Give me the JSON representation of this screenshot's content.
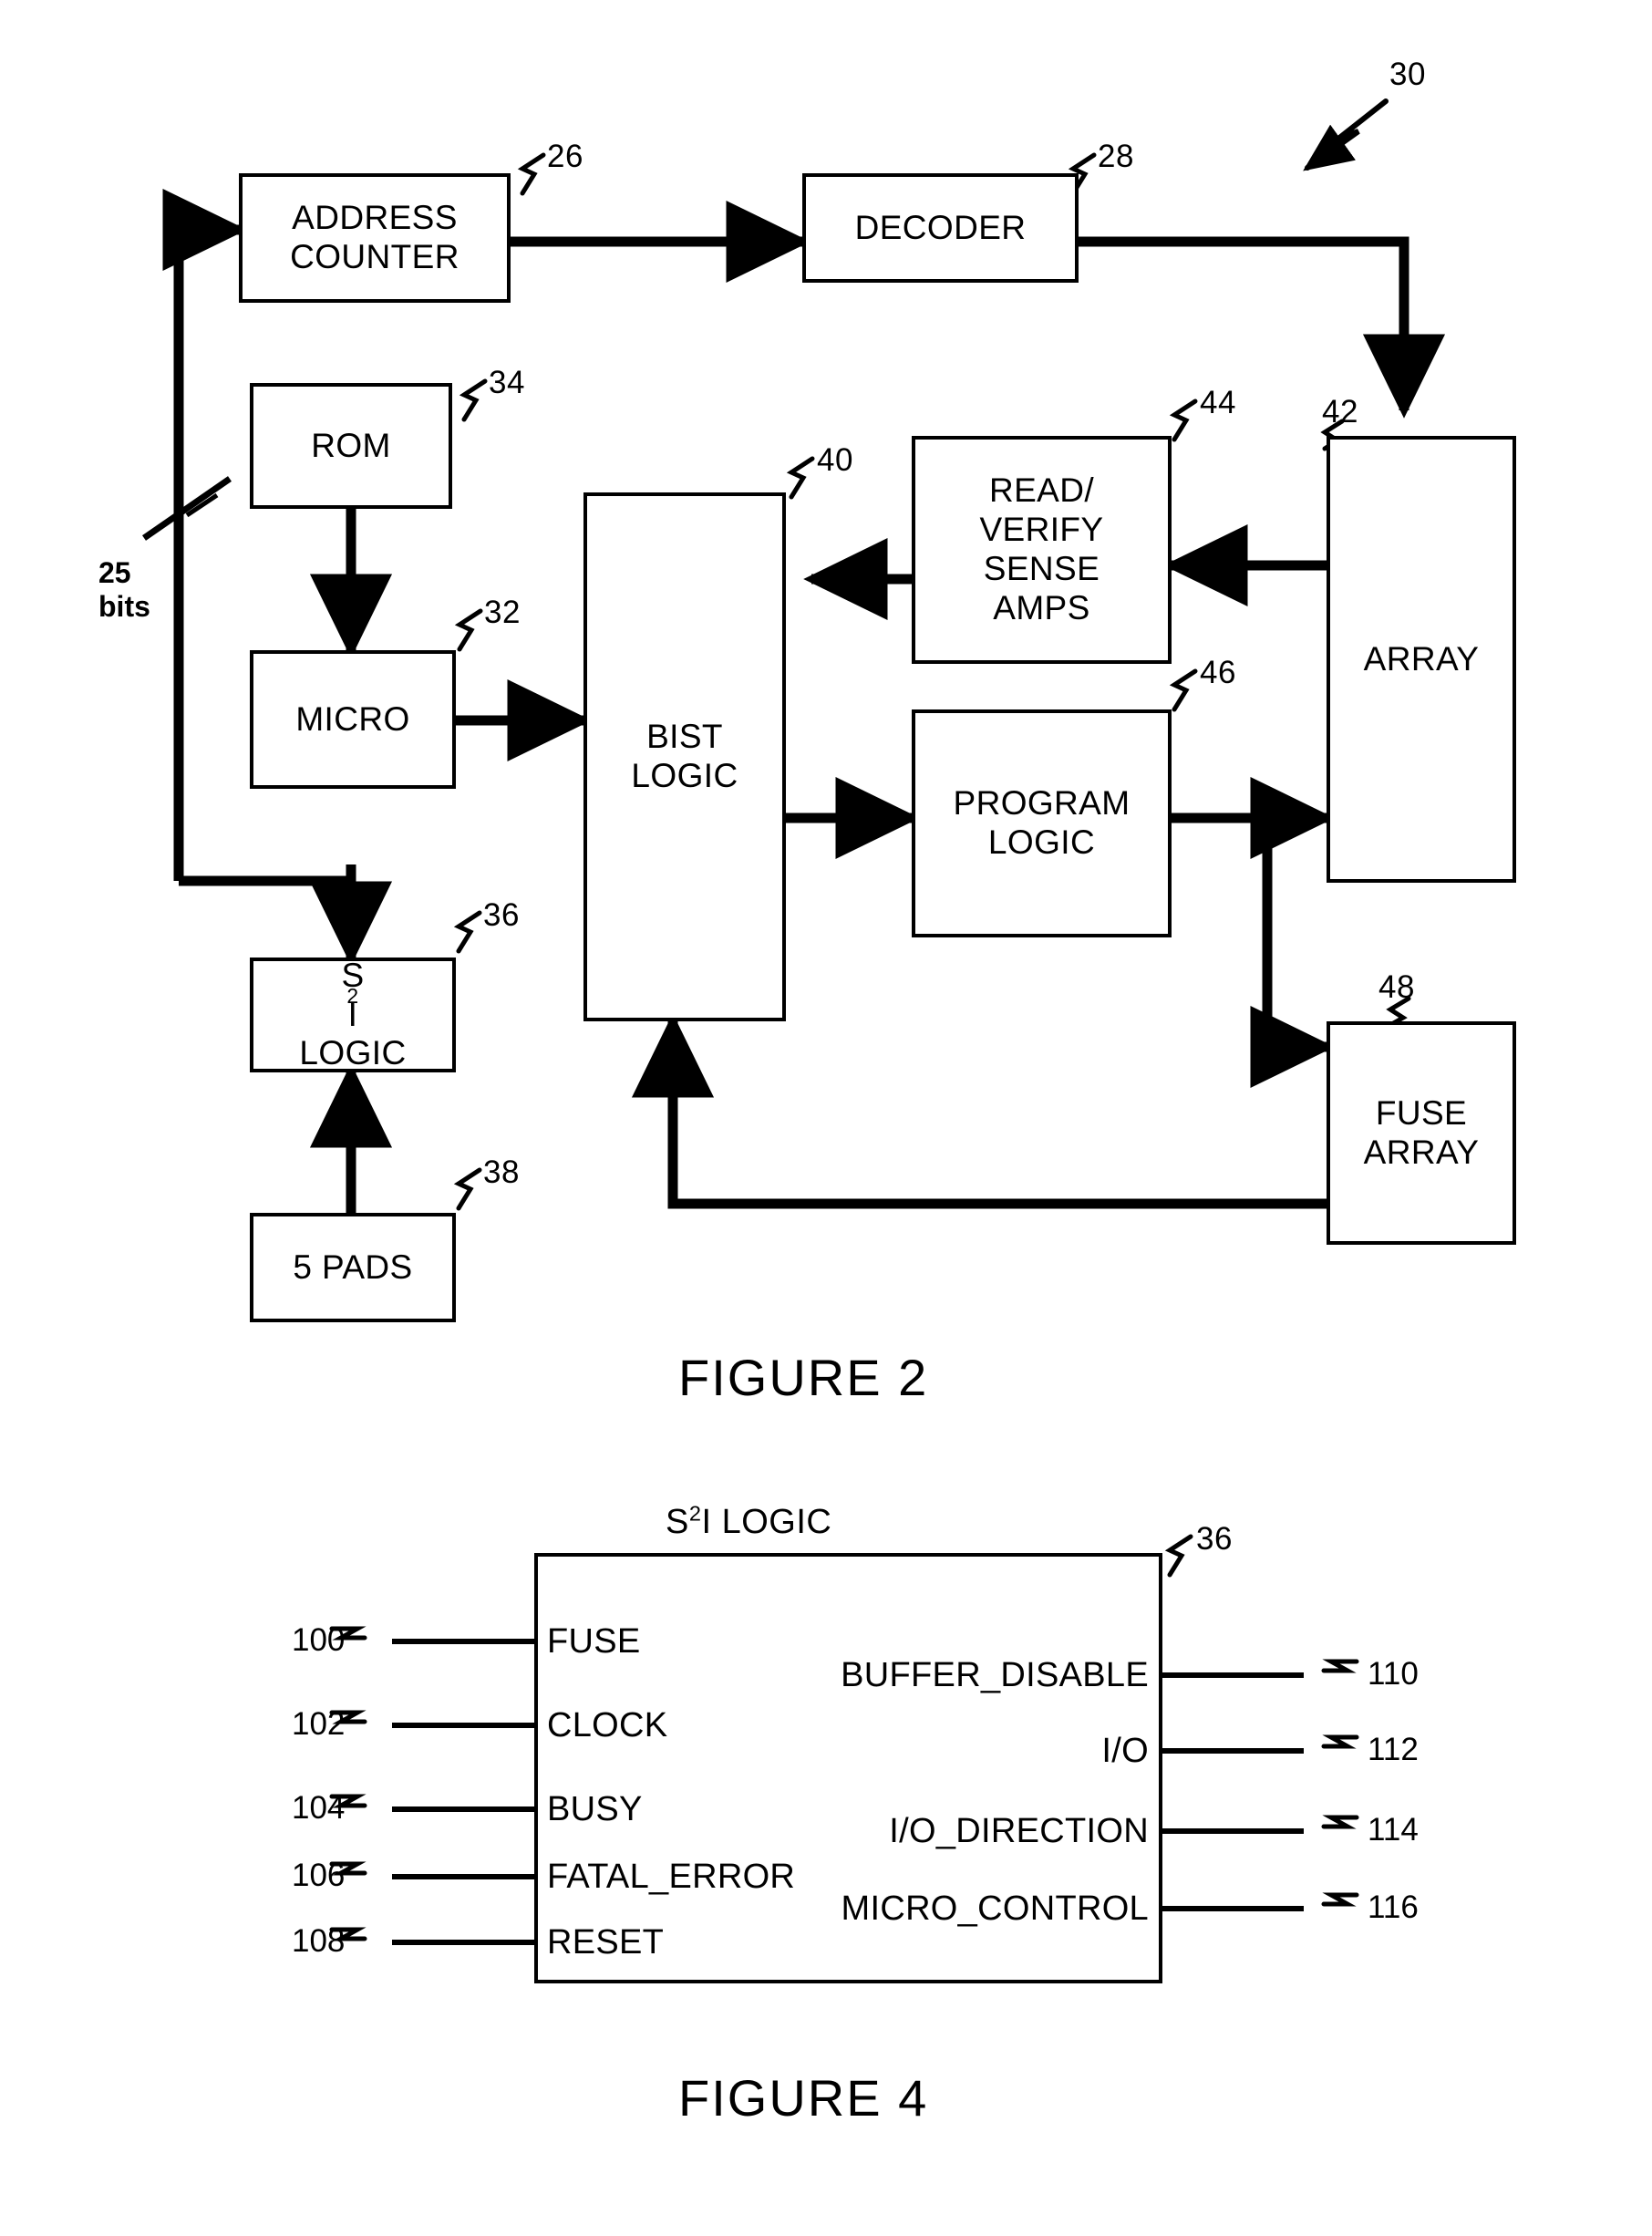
{
  "document": {
    "type": "patent-drawing-sheet",
    "ink_color": "#000000",
    "background_color": "#ffffff"
  },
  "figure2": {
    "caption": "FIGURE 2",
    "system_ref": "30",
    "bus_label_line1": "25",
    "bus_label_line2": "bits",
    "blocks": [
      {
        "id": "address-counter",
        "label_lines": [
          "ADDRESS",
          "COUNTER"
        ],
        "ref": "26"
      },
      {
        "id": "decoder",
        "label_lines": [
          "DECODER"
        ],
        "ref": "28"
      },
      {
        "id": "rom",
        "label_lines": [
          "ROM"
        ],
        "ref": "34"
      },
      {
        "id": "micro",
        "label_lines": [
          "MICRO"
        ],
        "ref": "32"
      },
      {
        "id": "s2i-logic",
        "label_lines": [
          "S2I",
          "LOGIC"
        ],
        "ref": "36"
      },
      {
        "id": "pads",
        "label_lines": [
          "5 PADS"
        ],
        "ref": "38"
      },
      {
        "id": "bist-logic",
        "label_lines": [
          "BIST",
          "LOGIC"
        ],
        "ref": "40"
      },
      {
        "id": "sense-amps",
        "label_lines": [
          "READ/",
          "VERIFY",
          "SENSE",
          "AMPS"
        ],
        "ref": "44"
      },
      {
        "id": "program-logic",
        "label_lines": [
          "PROGRAM",
          "LOGIC"
        ],
        "ref": "46"
      },
      {
        "id": "array",
        "label_lines": [
          "ARRAY"
        ],
        "ref": "42"
      },
      {
        "id": "fuse-array",
        "label_lines": [
          "FUSE",
          "ARRAY"
        ],
        "ref": "48"
      }
    ],
    "block_text": {
      "address_counter_l1": "ADDRESS",
      "address_counter_l2": "COUNTER",
      "decoder": "DECODER",
      "rom": "ROM",
      "micro": "MICRO",
      "s2i_logic_l2": "LOGIC",
      "pads": "5 PADS",
      "bist_l1": "BIST",
      "bist_l2": "LOGIC",
      "sense_l1": "READ/",
      "sense_l2": "VERIFY",
      "sense_l3": "SENSE",
      "sense_l4": "AMPS",
      "program_l1": "PROGRAM",
      "program_l2": "LOGIC",
      "array": "ARRAY",
      "fuse_l1": "FUSE",
      "fuse_l2": "ARRAY"
    },
    "refs": {
      "address_counter": "26",
      "decoder": "28",
      "system": "30",
      "micro": "32",
      "rom": "34",
      "s2i_logic": "36",
      "pads": "38",
      "bist_logic": "40",
      "array": "42",
      "sense_amps": "44",
      "program_logic": "46",
      "fuse_array": "48"
    }
  },
  "figure4": {
    "caption": "FIGURE 4",
    "title": "S2I LOGIC",
    "block_ref": "36",
    "inputs": [
      {
        "label": "FUSE",
        "ref": "100"
      },
      {
        "label": "CLOCK",
        "ref": "102"
      },
      {
        "label": "BUSY",
        "ref": "104"
      },
      {
        "label": "FATAL_ERROR",
        "ref": "106"
      },
      {
        "label": "RESET",
        "ref": "108"
      }
    ],
    "outputs": [
      {
        "label": "BUFFER_DISABLE",
        "ref": "110"
      },
      {
        "label": "I/O",
        "ref": "112"
      },
      {
        "label": "I/O_DIRECTION",
        "ref": "114"
      },
      {
        "label": "MICRO_CONTROL",
        "ref": "116"
      }
    ]
  }
}
